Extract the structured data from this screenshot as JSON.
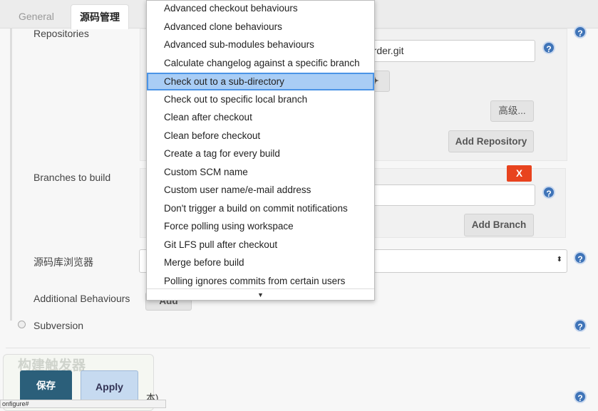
{
  "tabs": [
    {
      "label": "General"
    },
    {
      "label": "源码管理",
      "active": true
    }
  ],
  "repositories": {
    "label": "Repositories",
    "url_value": "/order.git",
    "advanced_label": "高级...",
    "add_repository_label": "Add Repository"
  },
  "branches": {
    "label": "Branches to build",
    "delete_label": "X",
    "add_branch_label": "Add Branch"
  },
  "browser": {
    "label": "源码库浏览器"
  },
  "additional": {
    "label": "Additional Behaviours",
    "add_label": "Add"
  },
  "subversion": {
    "label": "Subversion"
  },
  "trigger": {
    "label": "构建触发器",
    "partial_text": "本)"
  },
  "footer": {
    "save_label": "保存",
    "apply_label": "Apply"
  },
  "status_url": "onfigure#",
  "menu": {
    "items": [
      "Advanced checkout behaviours",
      "Advanced clone behaviours",
      "Advanced sub-modules behaviours",
      "Calculate changelog against a specific branch",
      "Check out to a sub-directory",
      "Check out to specific local branch",
      "Clean after checkout",
      "Clean before checkout",
      "Create a tag for every build",
      "Custom SCM name",
      "Custom user name/e-mail address",
      "Don't trigger a build on commit notifications",
      "Force polling using workspace",
      "Git LFS pull after checkout",
      "Merge before build",
      "Polling ignores commits from certain users"
    ],
    "highlighted_index": 4,
    "scroll_down_icon": "triangle-down"
  },
  "colors": {
    "save": "#2b5f7a",
    "apply": "#c6daf0",
    "delete": "#e8431e",
    "highlight": "#a9cdf5",
    "help": "#3f74b8"
  }
}
